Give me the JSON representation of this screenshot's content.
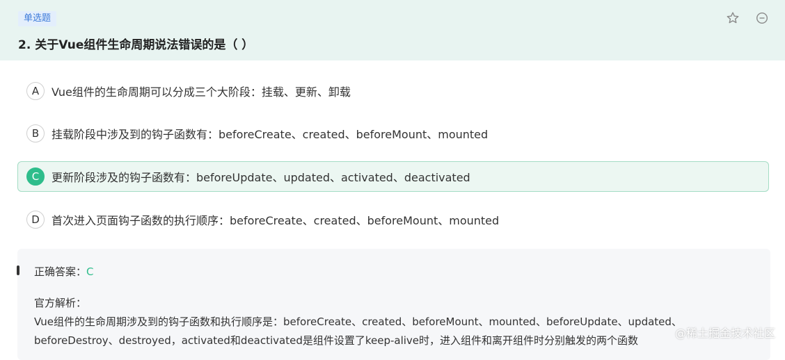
{
  "question": {
    "type_label": "单选题",
    "title": "2. 关于Vue组件生命周期说法错误的是（    ）",
    "icons": {
      "favorite": "star-outline-icon",
      "collapse": "minus-circle-icon"
    }
  },
  "options": [
    {
      "letter": "A",
      "text": "Vue组件的生命周期可以分成三个大阶段：挂载、更新、卸载",
      "selected": false
    },
    {
      "letter": "B",
      "text": "挂载阶段中涉及到的钩子函数有：beforeCreate、created、beforeMount、mounted",
      "selected": false
    },
    {
      "letter": "C",
      "text": "更新阶段涉及的钩子函数有：beforeUpdate、updated、activated、deactivated",
      "selected": true
    },
    {
      "letter": "D",
      "text": "首次进入页面钩子函数的执行顺序：beforeCreate、created、beforeMount、mounted",
      "selected": false
    }
  ],
  "answer": {
    "label": "正确答案：",
    "value": "C",
    "analysis_title": "官方解析：",
    "analysis_lines": [
      "Vue组件的生命周期涉及到的钩子函数和执行顺序是：beforeCreate、created、beforeMount、mounted、beforeUpdate、updated、",
      "beforeDestroy、destroyed，activated和deactivated是组件设置了keep-alive时，进入组件和离开组件时分别触发的两个函数"
    ]
  },
  "watermark": "@稀土掘金技术社区",
  "colors": {
    "header_bg": "#e8f4f1",
    "accent": "#2ebd8b",
    "badge": "#3d7bd9"
  }
}
